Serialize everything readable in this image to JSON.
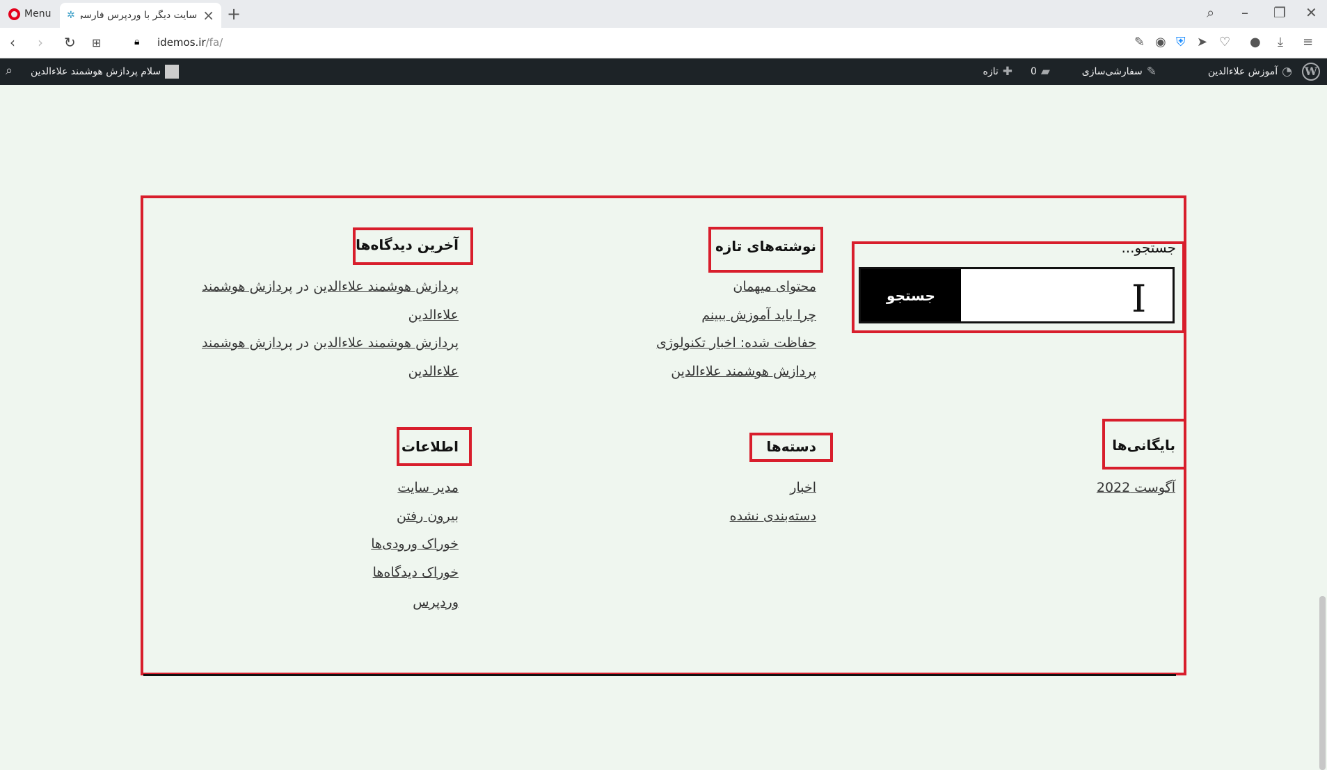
{
  "browser": {
    "menu_label": "Menu",
    "tab_title": "سایت دیگر با وردپرس فارسی",
    "url_host": "idemos.ir",
    "url_path": "/fa/"
  },
  "admin_bar": {
    "site_name": "آموزش علاءالدین",
    "customize": "سفارشی‌سازی",
    "comments_count": "0",
    "new": "تازه",
    "greeting": "سلام پردازش هوشمند علاءالدین"
  },
  "search_widget": {
    "label": "جستجو...",
    "placeholder": "",
    "button": "جستجو"
  },
  "recent_posts": {
    "title": "نوشته‌های تازه",
    "items": [
      "محتوای میهمان",
      "چرا باید آموزش ببینم",
      "حفاظت شده: اخبار تکنولوژی",
      "پردازش هوشمند علاءالدین"
    ]
  },
  "recent_comments": {
    "title": "آخرین دیدگاه‌ها",
    "items": [
      {
        "author": "پردازش هوشمند علاءالدین",
        "sep": "در",
        "post_part1": "پردازش هوشمند",
        "post_part2": "علاءالدین"
      },
      {
        "author": "پردازش هوشمند علاءالدین",
        "sep": "در",
        "post_part1": "پردازش هوشمند",
        "post_part2": "علاءالدین"
      }
    ]
  },
  "archives": {
    "title": "بایگانی‌ها",
    "items": [
      "آگوست 2022"
    ]
  },
  "categories": {
    "title": "دسته‌ها",
    "items": [
      "اخبار",
      "دسته‌بندی نشده"
    ]
  },
  "meta": {
    "title": "اطلاعات",
    "items": [
      "مدیر سایت",
      "بیرون رفتن",
      "خوراک ورودی‌ها",
      "خوراک دیدگاه‌ها",
      "وردپرس"
    ]
  },
  "colors": {
    "highlight": "#d81e2c",
    "page_bg": "#eff6ef",
    "admin_bar_bg": "#1d2327"
  }
}
